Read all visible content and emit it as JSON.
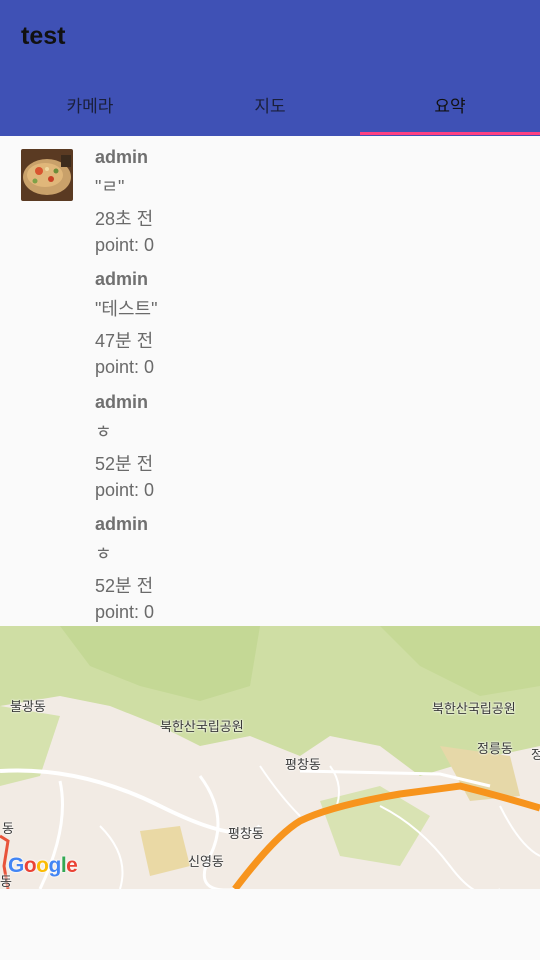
{
  "app": {
    "title": "test"
  },
  "tabs": [
    {
      "label": "카메라",
      "active": false
    },
    {
      "label": "지도",
      "active": false
    },
    {
      "label": "요약",
      "active": true
    }
  ],
  "colors": {
    "appbar": "#3f51b5",
    "indicator": "#ff4081",
    "route": "#f7941d"
  },
  "posts": [
    {
      "user": "admin",
      "message": "\"ㄹ\"",
      "time": "28초 전",
      "points": "point: 0",
      "has_image": true
    },
    {
      "user": "admin",
      "message": "\"테스트\"",
      "time": "47분 전",
      "points": "point: 0",
      "has_image": false
    },
    {
      "user": "admin",
      "message": "ㅎ",
      "time": "52분 전",
      "points": "point: 0",
      "has_image": false
    },
    {
      "user": "admin",
      "message": "ㅎ",
      "time": "52분 전",
      "points": "point: 0",
      "has_image": false
    }
  ],
  "map": {
    "labels": [
      "불광동",
      "북한산국립공원",
      "북한산국립공원",
      "정릉동",
      "평창동",
      "평창동",
      "신영동",
      "동",
      "정",
      "동"
    ],
    "logo": "Google"
  }
}
